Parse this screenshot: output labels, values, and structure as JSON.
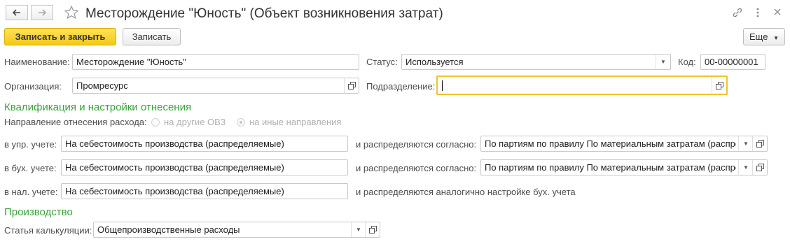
{
  "window": {
    "title": "Месторождение \"Юность\" (Объект возникновения затрат)",
    "icons": [
      "arrow-left-icon",
      "arrow-right-icon",
      "star-icon",
      "link-icon",
      "more-vertical-icon",
      "close-icon"
    ]
  },
  "toolbar": {
    "save_close": "Записать и закрыть",
    "save": "Записать",
    "more": "Еще"
  },
  "form": {
    "name_label": "Наименование:",
    "name_value": "Месторождение \"Юность\"",
    "status_label": "Статус:",
    "status_value": "Используется",
    "code_label": "Код:",
    "code_value": "00-00000001",
    "org_label": "Организация:",
    "org_value": "Промресурс",
    "dept_label": "Подразделение:",
    "dept_value": ""
  },
  "qualification": {
    "header": "Квалификация и настройки отнесения",
    "direction_label": "Направление отнесения расхода:",
    "radio_other_ovz": "на другие ОВЗ",
    "radio_other_dirs": "на иные направления",
    "rows": [
      {
        "label": "в упр. учете:",
        "value": "На себестоимость производства (распределяемые)",
        "distrib_label": "и распределяются согласно:",
        "distrib_value": "По партиям по правилу По материальным затратам (распре,"
      },
      {
        "label": "в бух. учете:",
        "value": "На себестоимость производства (распределяемые)",
        "distrib_label": "и распределяются согласно:",
        "distrib_value": "По партиям по правилу По материальным затратам (распре,"
      },
      {
        "label": "в нал. учете:",
        "value": "На себестоимость производства (распределяемые)",
        "distrib_label": "и распределяются аналогично настройке бух. учета"
      }
    ]
  },
  "production": {
    "header": "Производство",
    "cost_item_label": "Статья калькуляции:",
    "cost_item_value": "Общепроизводственные расходы"
  }
}
